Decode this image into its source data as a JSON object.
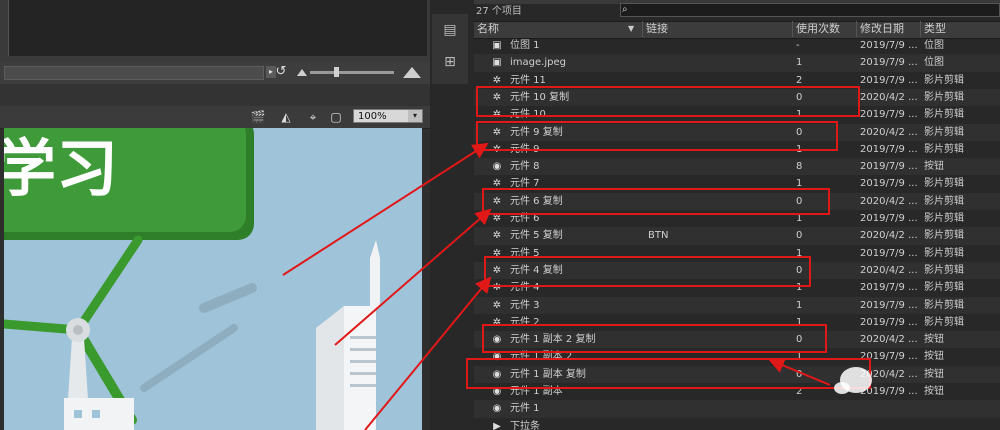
{
  "library": {
    "item_count": "27 个项目",
    "columns": {
      "name": "名称",
      "link": "链接",
      "uses": "使用次数",
      "date": "修改日期",
      "type": "类型"
    },
    "rows": [
      {
        "icon": "bitmap",
        "name": "位图 1",
        "link": "",
        "uses": "-",
        "date": "2019/7/9 ...",
        "type": "位图"
      },
      {
        "icon": "bitmap",
        "name": "image.jpeg",
        "link": "",
        "uses": "1",
        "date": "2019/7/9 ...",
        "type": "位图"
      },
      {
        "icon": "movieclip",
        "name": "元件 11",
        "link": "",
        "uses": "2",
        "date": "2019/7/9 ...",
        "type": "影片剪辑"
      },
      {
        "icon": "movieclip",
        "name": "元件 10 复制",
        "link": "",
        "uses": "0",
        "date": "2020/4/2 ...",
        "type": "影片剪辑"
      },
      {
        "icon": "movieclip",
        "name": "元件 10",
        "link": "",
        "uses": "1",
        "date": "2019/7/9 ...",
        "type": "影片剪辑"
      },
      {
        "icon": "movieclip",
        "name": "元件 9 复制",
        "link": "",
        "uses": "0",
        "date": "2020/4/2 ...",
        "type": "影片剪辑"
      },
      {
        "icon": "movieclip",
        "name": "元件 9",
        "link": "",
        "uses": "1",
        "date": "2019/7/9 ...",
        "type": "影片剪辑"
      },
      {
        "icon": "button",
        "name": "元件 8",
        "link": "",
        "uses": "8",
        "date": "2019/7/9 ...",
        "type": "按钮"
      },
      {
        "icon": "movieclip",
        "name": "元件 7",
        "link": "",
        "uses": "1",
        "date": "2019/7/9 ...",
        "type": "影片剪辑"
      },
      {
        "icon": "movieclip",
        "name": "元件 6 复制",
        "link": "",
        "uses": "0",
        "date": "2020/4/2 ...",
        "type": "影片剪辑"
      },
      {
        "icon": "movieclip",
        "name": "元件 6",
        "link": "",
        "uses": "1",
        "date": "2019/7/9 ...",
        "type": "影片剪辑"
      },
      {
        "icon": "movieclip",
        "name": "元件 5 复制",
        "link": "BTN",
        "uses": "0",
        "date": "2020/4/2 ...",
        "type": "影片剪辑"
      },
      {
        "icon": "movieclip",
        "name": "元件 5",
        "link": "",
        "uses": "1",
        "date": "2019/7/9 ...",
        "type": "影片剪辑"
      },
      {
        "icon": "movieclip",
        "name": "元件 4 复制",
        "link": "",
        "uses": "0",
        "date": "2020/4/2 ...",
        "type": "影片剪辑"
      },
      {
        "icon": "movieclip",
        "name": "元件 4",
        "link": "",
        "uses": "1",
        "date": "2019/7/9 ...",
        "type": "影片剪辑"
      },
      {
        "icon": "movieclip",
        "name": "元件 3",
        "link": "",
        "uses": "1",
        "date": "2019/7/9 ...",
        "type": "影片剪辑"
      },
      {
        "icon": "movieclip",
        "name": "元件 2",
        "link": "",
        "uses": "1",
        "date": "2019/7/9 ...",
        "type": "影片剪辑"
      },
      {
        "icon": "button",
        "name": "元件 1 副本 2 复制",
        "link": "",
        "uses": "0",
        "date": "2020/4/2 ...",
        "type": "按钮"
      },
      {
        "icon": "button",
        "name": "元件 1 副本 2",
        "link": "",
        "uses": "1",
        "date": "2019/7/9 ...",
        "type": "按钮"
      },
      {
        "icon": "button",
        "name": "元件 1 副本 复制",
        "link": "",
        "uses": "0",
        "date": "2020/4/2 ...",
        "type": "按钮"
      },
      {
        "icon": "button",
        "name": "元件 1 副本",
        "link": "",
        "uses": "2",
        "date": "2019/7/9 ...",
        "type": "按钮"
      },
      {
        "icon": "button",
        "name": "元件 1",
        "link": "",
        "uses": "",
        "date": "",
        "type": ""
      },
      {
        "icon": "folder",
        "name": "下拉条",
        "link": "",
        "uses": "",
        "date": "",
        "type": ""
      }
    ]
  },
  "stage": {
    "zoom_value": "100%",
    "art_text": "学习",
    "colors": {
      "sky": "#9fc4da",
      "banner": "#3f9a3a",
      "banner_edge": "#2e7e2a",
      "windmill_blade": "#3b9a2e",
      "building": "#eef1f3",
      "annotation_red": "#e01818"
    }
  },
  "icons": {
    "bitmap": "▣",
    "movieclip": "✲",
    "button": "◉",
    "folder": "▶",
    "search": "⌕",
    "loop": "↺",
    "sort": "▼",
    "dropdown": "▾"
  }
}
